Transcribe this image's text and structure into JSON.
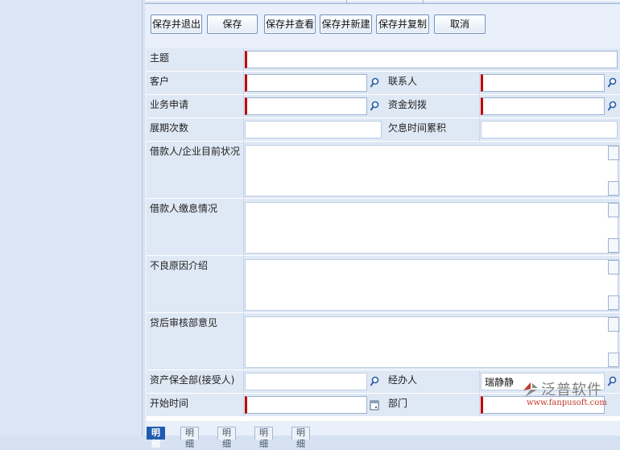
{
  "toolbar": {
    "save_exit": "保存并退出",
    "save": "保存",
    "save_view": "保存并查看",
    "save_new": "保存并新建",
    "save_copy": "保存并复制",
    "cancel": "取消"
  },
  "form": {
    "subject": {
      "label": "主题",
      "value": ""
    },
    "customer": {
      "label": "客户",
      "value": ""
    },
    "contact": {
      "label": "联系人",
      "value": ""
    },
    "business_application": {
      "label": "业务申请",
      "value": ""
    },
    "fund_allocation": {
      "label": "资金划拨",
      "value": ""
    },
    "extension_count": {
      "label": "展期次数",
      "value": ""
    },
    "overdue_interest": {
      "label": "欠息时间累积",
      "value": ""
    },
    "borrower_status": {
      "label": "借款人/企业目前状况",
      "value": ""
    },
    "borrower_interest": {
      "label": "借款人缴息情况",
      "value": ""
    },
    "bad_reason": {
      "label": "不良原因介绍",
      "value": ""
    },
    "post_loan_review": {
      "label": "贷后审核部意见",
      "value": ""
    },
    "asset_dept": {
      "label": "资产保全部(接受人)",
      "value": ""
    },
    "handler": {
      "label": "经办人",
      "value": "瑞静静"
    },
    "start_time": {
      "label": "开始时间",
      "value": ""
    },
    "department": {
      "label": "部门",
      "value": ""
    }
  },
  "tabs": [
    "明细",
    "明细",
    "明细",
    "明细",
    "明细"
  ],
  "watermark": {
    "brand": "泛普软件",
    "url": "www.fanpusoft.com"
  },
  "icons": {
    "lookup": "search-icon",
    "date": "calendar-icon"
  },
  "colors": {
    "required_marker": "#c00000",
    "label_bg": "#dfe8f5",
    "active_tab": "#1f5cb0"
  }
}
